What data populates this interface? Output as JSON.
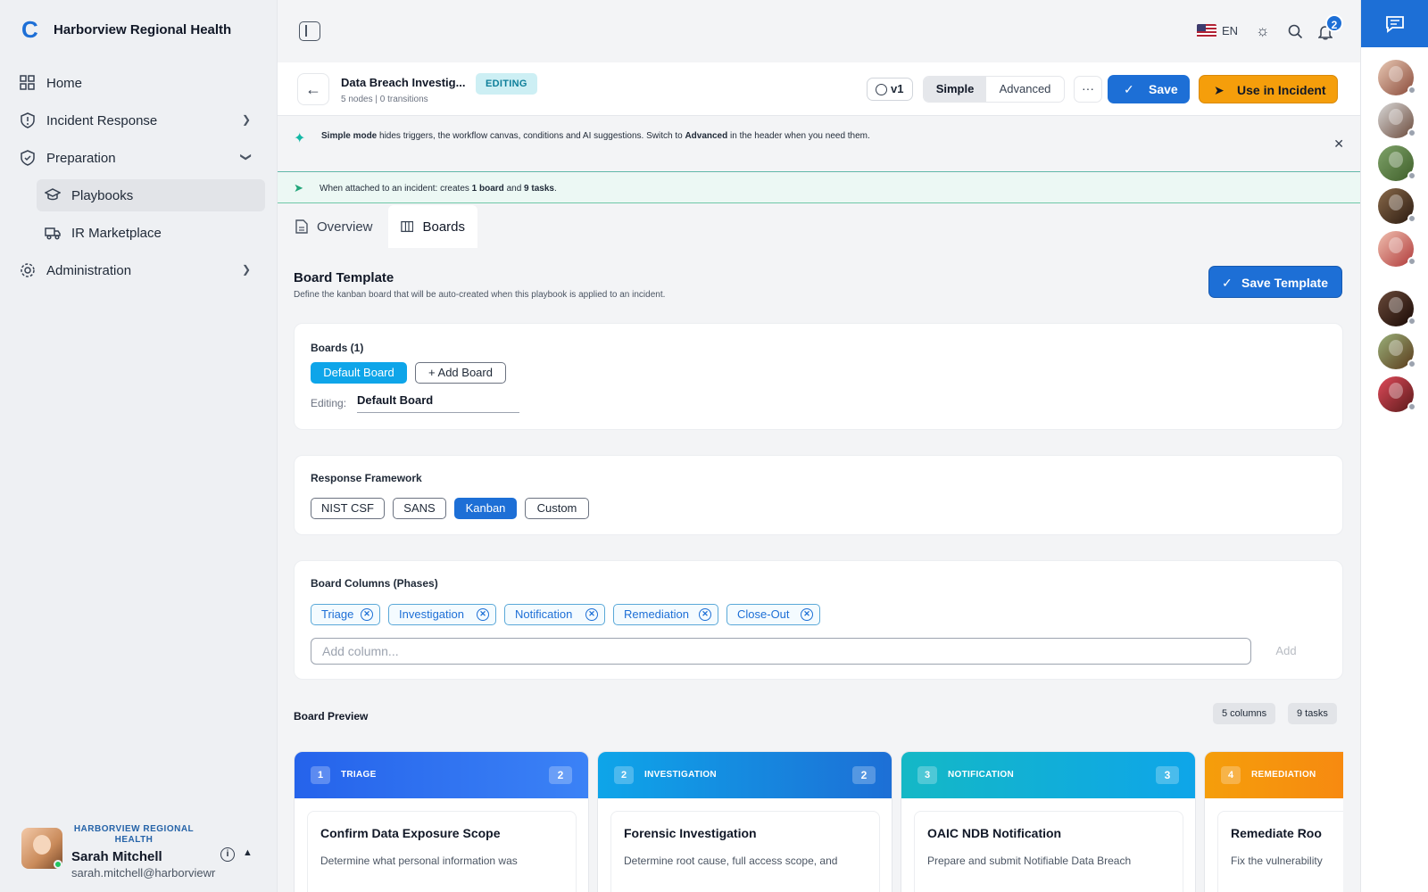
{
  "app": {
    "name": "Harborview Regional Health"
  },
  "sidebar": {
    "items": [
      {
        "label": "Home",
        "icon": "grid-icon"
      },
      {
        "label": "Incident Response",
        "icon": "shield-alert-icon"
      },
      {
        "label": "Preparation",
        "icon": "shield-check-icon"
      },
      {
        "label": "Playbooks",
        "icon": "cap-icon"
      },
      {
        "label": "IR Marketplace",
        "icon": "truck-icon"
      },
      {
        "label": "Administration",
        "icon": "gear-icon"
      }
    ]
  },
  "user": {
    "org": "HARBORVIEW REGIONAL HEALTH",
    "name": "Sarah Mitchell",
    "email": "sarah.mitchell@harborviewr"
  },
  "topbar": {
    "language": "EN",
    "notifications": "2"
  },
  "header": {
    "title": "Data Breach Investig...",
    "subtitle": "5 nodes | 0 transitions",
    "status": "EDITING",
    "version": "v1",
    "mode_simple": "Simple",
    "mode_advanced": "Advanced",
    "more": "···",
    "save": "Save",
    "use": "Use in Incident"
  },
  "banner": {
    "simple": "Simple mode",
    "text1": " hides triggers, the workflow canvas, conditions and AI suggestions. Switch to ",
    "advanced": "Advanced",
    "text2": " in the header when you need them."
  },
  "attach": {
    "pre": "When attached to an incident: creates ",
    "boards": "1 board",
    "mid": " and ",
    "tasks": "9 tasks",
    "post": "."
  },
  "tabs": [
    {
      "label": "Overview"
    },
    {
      "label": "Boards"
    }
  ],
  "board_template": {
    "title": "Board Template",
    "desc": "Define the kanban board that will be auto-created when this playbook is applied to an incident.",
    "save": "Save Template"
  },
  "boards": {
    "heading": "Boards (1)",
    "default": "Default Board",
    "add": "Add Board",
    "editing_label": "Editing:",
    "editing_value": "Default Board"
  },
  "framework": {
    "heading": "Response Framework",
    "options": [
      "NIST CSF",
      "SANS",
      "Kanban",
      "Custom"
    ]
  },
  "columns": {
    "heading": "Board Columns (Phases)",
    "items": [
      "Triage",
      "Investigation",
      "Notification",
      "Remediation",
      "Close-Out"
    ],
    "placeholder": "Add column...",
    "add": "Add"
  },
  "preview": {
    "title": "Board Preview",
    "columns_badge": "5 columns",
    "tasks_badge": "9 tasks",
    "cols": [
      {
        "num": "1",
        "name": "TRIAGE",
        "count": "2",
        "color": "#2f6fe6",
        "task": "Confirm Data Exposure Scope",
        "desc": "Determine what personal information was"
      },
      {
        "num": "2",
        "name": "INVESTIGATION",
        "count": "2",
        "color": "#1794d8",
        "task": "Forensic Investigation",
        "desc": "Determine root cause, full access scope, and"
      },
      {
        "num": "3",
        "name": "NOTIFICATION",
        "count": "3",
        "color": "#0eaac6",
        "task": "OAIC NDB Notification",
        "desc": "Prepare and submit Notifiable Data Breach"
      },
      {
        "num": "4",
        "name": "REMEDIATION",
        "count": "",
        "color": "#f59e0b",
        "task": "Remediate Roo",
        "desc": "Fix the vulnerability"
      }
    ]
  }
}
